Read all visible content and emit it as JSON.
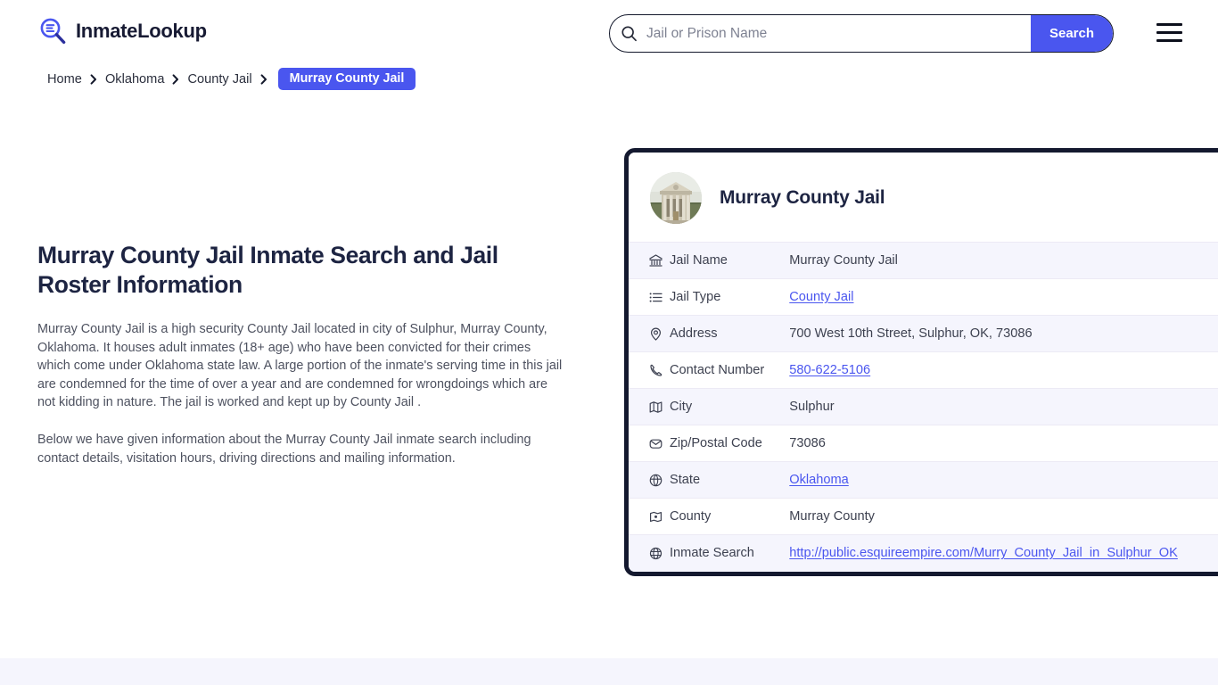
{
  "header": {
    "brand_name": "InmateLookup",
    "brand_icon": "magnifier-list-icon",
    "search": {
      "placeholder": "Jail or Prison Name",
      "value": "",
      "button_label": "Search",
      "icon": "search-icon"
    },
    "menu_icon": "hamburger-menu-icon",
    "accent_color": "#4a56ef",
    "dark_color": "#14192f"
  },
  "breadcrumb": {
    "items": [
      {
        "label": "Home",
        "current": false
      },
      {
        "label": "Oklahoma",
        "current": false
      },
      {
        "label": "County Jail",
        "current": false
      },
      {
        "label": "Murray County Jail",
        "current": true
      }
    ],
    "separator_icon": "chevron-right-icon"
  },
  "main": {
    "title": "Murray County Jail Inmate Search and Jail Roster Information",
    "paragraphs": [
      "Murray County Jail is a high security County Jail located in city of Sulphur, Murray County, Oklahoma. It houses adult inmates (18+ age) who have been convicted for their crimes which come under Oklahoma state law. A large portion of the inmate's serving time in this jail are condemned for the time of over a year and are condemned for wrongdoings which are not kidding in nature. The jail is worked and kept up by County Jail .",
      "Below we have given information about the Murray County Jail inmate search including contact details, visitation hours, driving directions and mailing information."
    ]
  },
  "card": {
    "title": "Murray County Jail",
    "avatar_icon": "courthouse-photo",
    "rows": [
      {
        "icon": "bank-icon",
        "label": "Jail Name",
        "value": "Murray County Jail",
        "link": false
      },
      {
        "icon": "list-icon",
        "label": "Jail Type",
        "value": "County Jail",
        "link": true
      },
      {
        "icon": "map-pin-icon",
        "label": "Address",
        "value": "700 West 10th Street, Sulphur, OK, 73086",
        "link": false
      },
      {
        "icon": "phone-icon",
        "label": "Contact Number",
        "value": "580-622-5106",
        "link": true
      },
      {
        "icon": "map-icon",
        "label": "City",
        "value": "Sulphur",
        "link": false
      },
      {
        "icon": "envelope-icon",
        "label": "Zip/Postal Code",
        "value": "73086",
        "link": false
      },
      {
        "icon": "globe-pin-icon",
        "label": "State",
        "value": "Oklahoma",
        "link": true
      },
      {
        "icon": "county-map-icon",
        "label": "County",
        "value": "Murray County",
        "link": false
      },
      {
        "icon": "globe-icon",
        "label": "Inmate Search",
        "value": "http://public.esquireempire.com/Murry_County_Jail_in_Sulphur_OK",
        "link": true
      }
    ]
  }
}
